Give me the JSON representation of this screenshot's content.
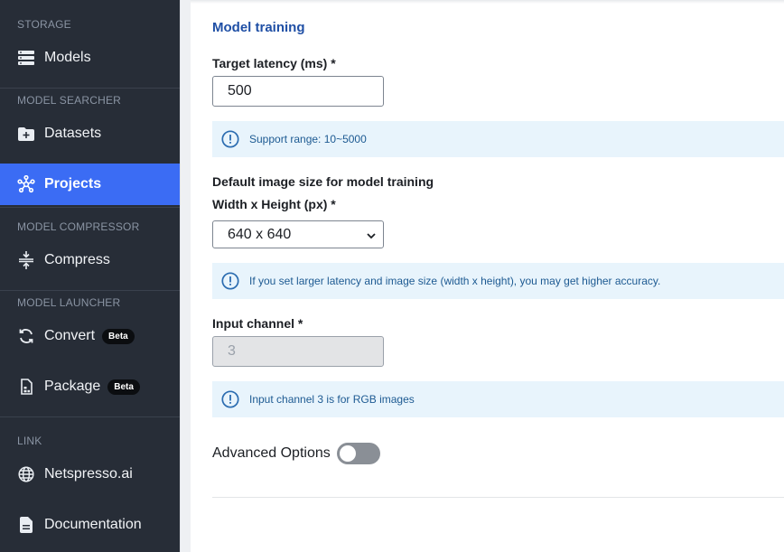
{
  "sidebar": {
    "sections": {
      "storage": "STORAGE",
      "model_searcher": "MODEL SEARCHER",
      "model_compressor": "MODEL COMPRESSOR",
      "model_launcher": "MODEL LAUNCHER",
      "link": "LINK"
    },
    "items": {
      "models": {
        "label": "Models",
        "icon": "server-stack-icon"
      },
      "datasets": {
        "label": "Datasets",
        "icon": "folder-plus-icon"
      },
      "projects": {
        "label": "Projects",
        "icon": "network-nodes-icon",
        "active": true
      },
      "compress": {
        "label": "Compress",
        "icon": "compress-icon"
      },
      "convert": {
        "label": "Convert",
        "icon": "refresh-icon",
        "badge": "Beta"
      },
      "package": {
        "label": "Package",
        "icon": "package-file-icon",
        "badge": "Beta"
      },
      "netspresso": {
        "label": "Netspresso.ai",
        "icon": "globe-icon"
      },
      "documentation": {
        "label": "Documentation",
        "icon": "document-icon"
      }
    }
  },
  "main": {
    "title": "Model training",
    "target_latency": {
      "label": "Target latency (ms) *",
      "value": "500",
      "info": "Support range: 10~5000"
    },
    "image_size": {
      "heading": "Default image size for model training",
      "label": "Width x Height (px) *",
      "selected": "640 x 640",
      "info": "If you set larger latency and image size (width x height), you may get higher accuracy."
    },
    "input_channel": {
      "label": "Input channel *",
      "value": "3",
      "info": "Input channel 3 is for RGB images"
    },
    "advanced_options": {
      "label": "Advanced Options",
      "enabled": false
    }
  },
  "colors": {
    "sidebar_bg": "#272d37",
    "active_bg": "#3b6cf4",
    "title": "#1f4fa5",
    "info_bg": "#e8f4fc",
    "info_text": "#1d5a92"
  }
}
